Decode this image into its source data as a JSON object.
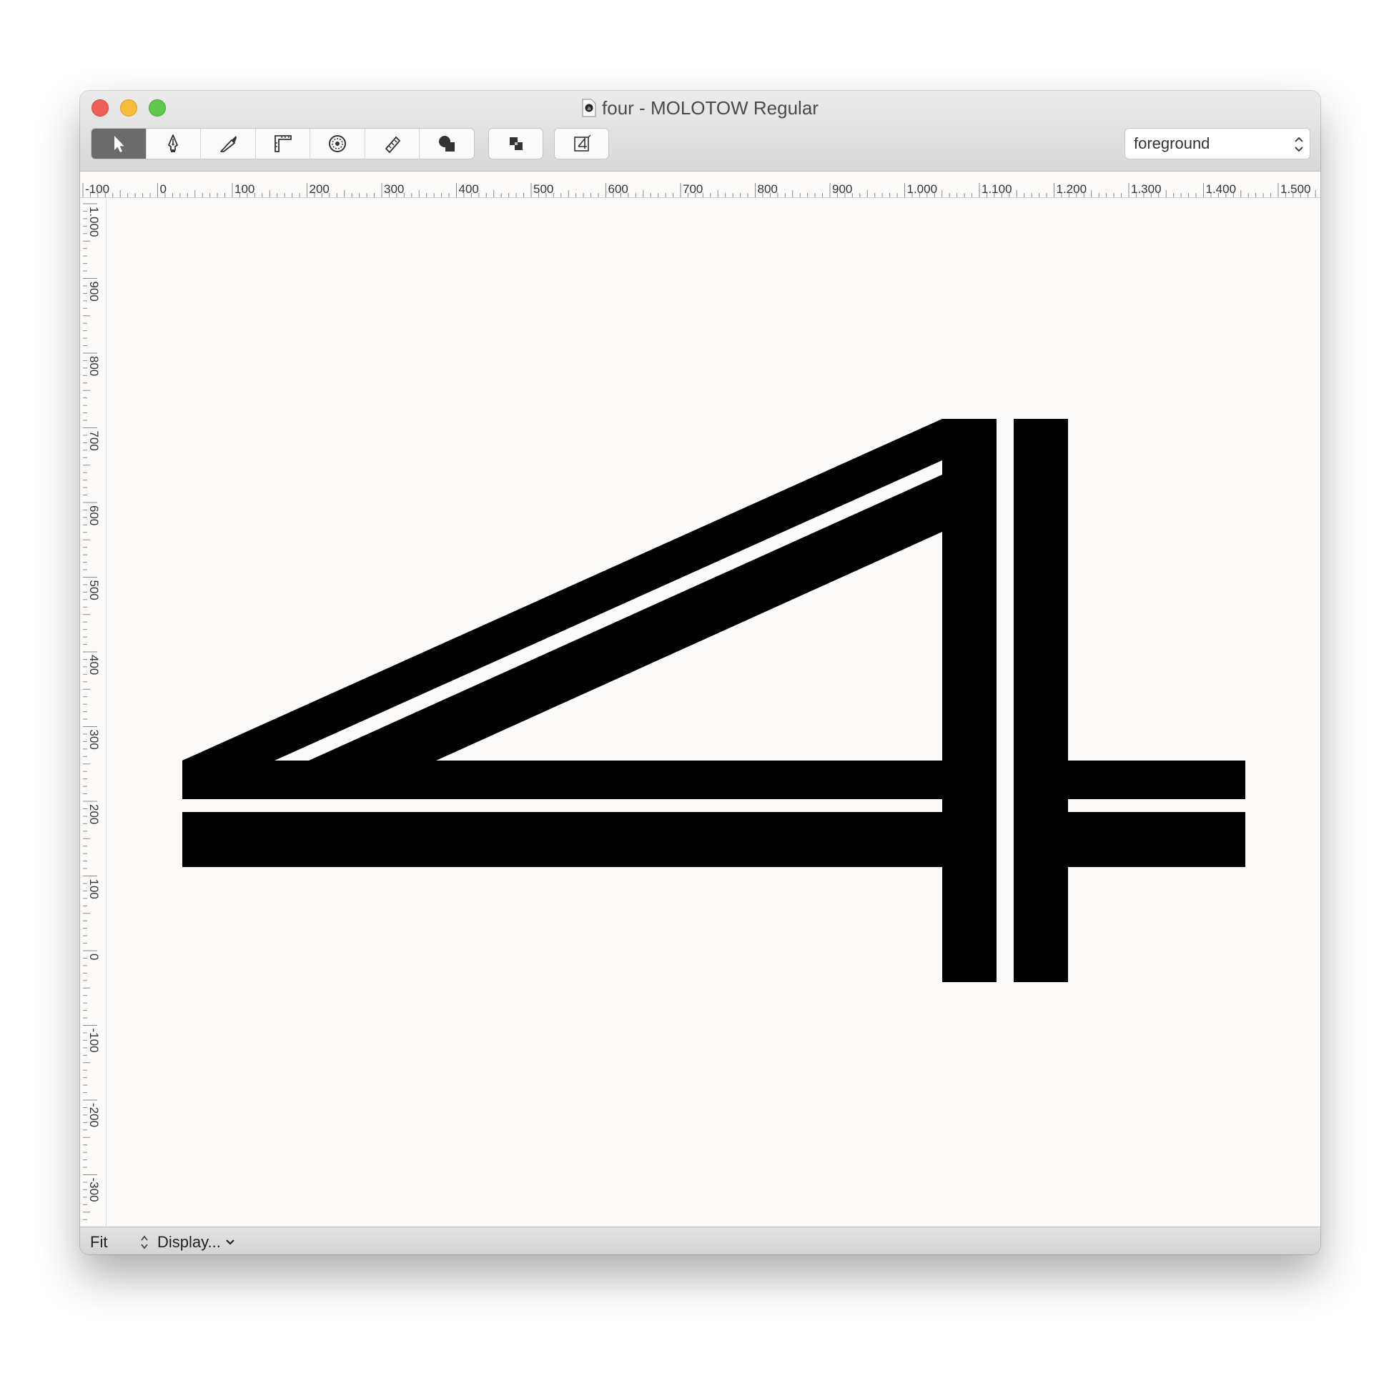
{
  "window": {
    "title": "four - MOLOTOW Regular"
  },
  "toolbar": {
    "tools": [
      {
        "name": "pointer-tool",
        "icon": "arrow-pointer-icon",
        "active": true
      },
      {
        "name": "pen-tool",
        "icon": "pen-nib-icon",
        "active": false
      },
      {
        "name": "knife-tool",
        "icon": "knife-icon",
        "active": false
      },
      {
        "name": "ruler-tool",
        "icon": "ruler-icon",
        "active": false
      },
      {
        "name": "shapes-tool",
        "icon": "shapes-wheel-icon",
        "active": false
      },
      {
        "name": "measure-tool",
        "icon": "measuring-tape-icon",
        "active": false
      },
      {
        "name": "boolean-tool",
        "icon": "overlapping-shapes-icon",
        "active": false
      }
    ],
    "overlap_button_icon": "overlap-squares-icon",
    "glyph_button_icon": "glyph-preview-icon",
    "layer_select": {
      "value": "foreground"
    }
  },
  "ruler": {
    "horizontal_labels": [
      "-100",
      "0",
      "100",
      "200",
      "300",
      "400",
      "500",
      "600",
      "700",
      "800",
      "900",
      "1.000",
      "1.100",
      "1.200",
      "1.300",
      "1.400",
      "1.500"
    ],
    "vertical_labels": [
      "1.000",
      "900",
      "800",
      "700",
      "600",
      "500",
      "400",
      "300",
      "200",
      "100",
      "0",
      "-100",
      "-200",
      "-300"
    ]
  },
  "status": {
    "zoom": "Fit",
    "display_label": "Display..."
  },
  "colors": {
    "glyph_fill": "#000000",
    "canvas_bg": "#fcfbf9",
    "active_tool_bg": "#6b6b6b"
  }
}
